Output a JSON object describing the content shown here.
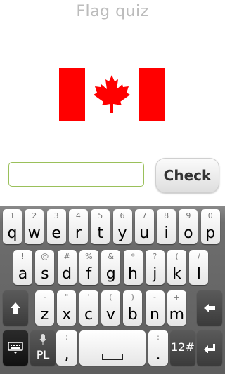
{
  "app": {
    "title": "Flag quiz"
  },
  "quiz": {
    "flag_name": "flag-of-canada",
    "answer_value": "",
    "check_label": "Check"
  },
  "colors": {
    "flag_red": "#ff0000",
    "input_border": "#9ac05a"
  },
  "keyboard": {
    "row1": [
      {
        "hint": "1",
        "label": "q"
      },
      {
        "hint": "2",
        "label": "w"
      },
      {
        "hint": "3",
        "label": "e"
      },
      {
        "hint": "4",
        "label": "r"
      },
      {
        "hint": "5",
        "label": "t"
      },
      {
        "hint": "6",
        "label": "y"
      },
      {
        "hint": "7",
        "label": "u"
      },
      {
        "hint": "8",
        "label": "i"
      },
      {
        "hint": "9",
        "label": "o"
      },
      {
        "hint": "0",
        "label": "p"
      }
    ],
    "row2": [
      {
        "hint": "!",
        "label": "a"
      },
      {
        "hint": "@",
        "label": "s"
      },
      {
        "hint": "#",
        "label": "d"
      },
      {
        "hint": "%",
        "label": "f"
      },
      {
        "hint": "&",
        "label": "g"
      },
      {
        "hint": "*",
        "label": "h"
      },
      {
        "hint": "?",
        "label": "j"
      },
      {
        "hint": "(",
        "label": "k"
      },
      {
        "hint": "/",
        "label": "l"
      }
    ],
    "row3": [
      {
        "hint": "-",
        "label": "z"
      },
      {
        "hint": "\"",
        "label": "x"
      },
      {
        "hint": "'",
        "label": "c"
      },
      {
        "hint": "(",
        "label": "v"
      },
      {
        "hint": ")",
        "label": "b"
      },
      {
        "hint": "-",
        "label": "n"
      },
      {
        "hint": "+",
        "label": "m"
      }
    ],
    "row4": {
      "mic_label": "PL",
      "comma_hint": ";",
      "comma_label": ",",
      "period_hint": ":",
      "period_label": ".",
      "symbols_label": "12#"
    }
  }
}
